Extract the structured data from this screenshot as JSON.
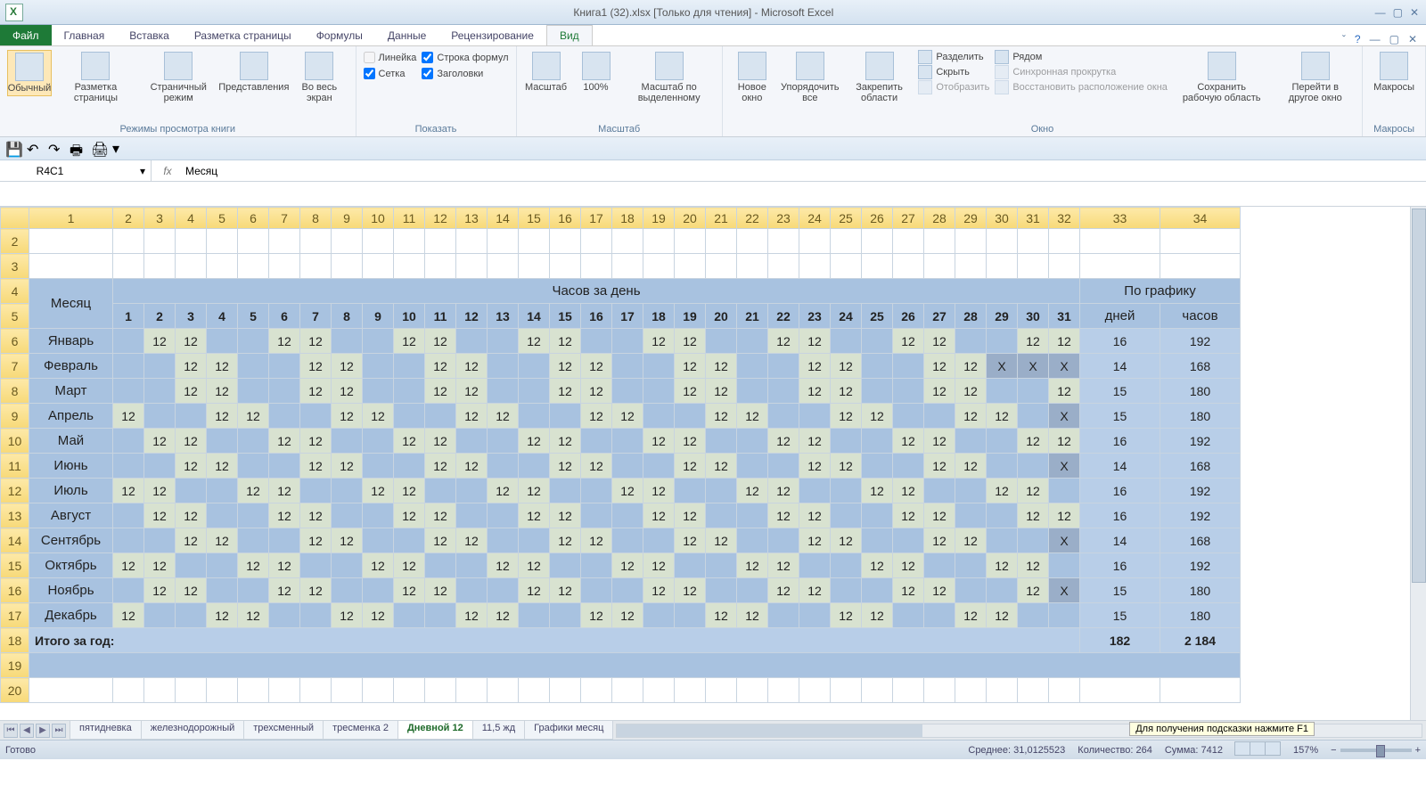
{
  "titlebar": {
    "title": "Книга1 (32).xlsx  [Только для чтения]  -  Microsoft Excel"
  },
  "tabs": {
    "file": "Файл",
    "items": [
      "Главная",
      "Вставка",
      "Разметка страницы",
      "Формулы",
      "Данные",
      "Рецензирование",
      "Вид"
    ],
    "active": "Вид"
  },
  "ribbon": {
    "groups": {
      "views": {
        "label": "Режимы просмотра книги",
        "normal": "Обычный",
        "pagelayout": "Разметка страницы",
        "pagebreak": "Страничный режим",
        "custom": "Представления",
        "full": "Во весь экран"
      },
      "show": {
        "label": "Показать",
        "ruler": "Линейка",
        "formula": "Строка формул",
        "grid": "Сетка",
        "headings": "Заголовки"
      },
      "zoom": {
        "label": "Масштаб",
        "zoom": "Масштаб",
        "z100": "100%",
        "zsel": "Масштаб по выделенному"
      },
      "window": {
        "label": "Окно",
        "neww": "Новое окно",
        "arrange": "Упорядочить все",
        "freeze": "Закрепить области",
        "split": "Разделить",
        "hide": "Скрыть",
        "unhide": "Отобразить",
        "side": "Рядом",
        "sync": "Синхронная прокрутка",
        "reset": "Восстановить расположение окна",
        "save": "Сохранить рабочую область",
        "switch": "Перейти в другое окно"
      },
      "macros": {
        "label": "Макросы",
        "btn": "Макросы"
      }
    }
  },
  "namebox": "R4C1",
  "formula": "Месяц",
  "columns": [
    "1",
    "2",
    "3",
    "4",
    "5",
    "6",
    "7",
    "8",
    "9",
    "10",
    "11",
    "12",
    "13",
    "14",
    "15",
    "16",
    "17",
    "18",
    "19",
    "20",
    "21",
    "22",
    "23",
    "24",
    "25",
    "26",
    "27",
    "28",
    "29",
    "30",
    "31",
    "32",
    "33",
    "34"
  ],
  "headers": {
    "month": "Месяц",
    "hoursPerDay": "Часов за день",
    "bySchedule": "По графику",
    "days": "дней",
    "hours": "часов"
  },
  "dayNums": [
    "1",
    "2",
    "3",
    "4",
    "5",
    "6",
    "7",
    "8",
    "9",
    "10",
    "11",
    "12",
    "13",
    "14",
    "15",
    "16",
    "17",
    "18",
    "19",
    "20",
    "21",
    "22",
    "23",
    "24",
    "25",
    "26",
    "27",
    "28",
    "29",
    "30",
    "31"
  ],
  "months": [
    {
      "name": "Январь",
      "cells": [
        "",
        "12",
        "12",
        "",
        "",
        "12",
        "12",
        "",
        "",
        "12",
        "12",
        "",
        "",
        "12",
        "12",
        "",
        "",
        "12",
        "12",
        "",
        "",
        "12",
        "12",
        "",
        "",
        "12",
        "12",
        "",
        "",
        "12",
        "12"
      ],
      "days": "16",
      "hours": "192"
    },
    {
      "name": "Февраль",
      "cells": [
        "",
        "",
        "12",
        "12",
        "",
        "",
        "12",
        "12",
        "",
        "",
        "12",
        "12",
        "",
        "",
        "12",
        "12",
        "",
        "",
        "12",
        "12",
        "",
        "",
        "12",
        "12",
        "",
        "",
        "12",
        "12",
        "X",
        "X",
        "X"
      ],
      "days": "14",
      "hours": "168"
    },
    {
      "name": "Март",
      "cells": [
        "",
        "",
        "12",
        "12",
        "",
        "",
        "12",
        "12",
        "",
        "",
        "12",
        "12",
        "",
        "",
        "12",
        "12",
        "",
        "",
        "12",
        "12",
        "",
        "",
        "12",
        "12",
        "",
        "",
        "12",
        "12",
        "",
        "",
        "12"
      ],
      "days": "15",
      "hours": "180"
    },
    {
      "name": "Апрель",
      "cells": [
        "12",
        "",
        "",
        "12",
        "12",
        "",
        "",
        "12",
        "12",
        "",
        "",
        "12",
        "12",
        "",
        "",
        "12",
        "12",
        "",
        "",
        "12",
        "12",
        "",
        "",
        "12",
        "12",
        "",
        "",
        "12",
        "12",
        "",
        "X"
      ],
      "days": "15",
      "hours": "180"
    },
    {
      "name": "Май",
      "cells": [
        "",
        "12",
        "12",
        "",
        "",
        "12",
        "12",
        "",
        "",
        "12",
        "12",
        "",
        "",
        "12",
        "12",
        "",
        "",
        "12",
        "12",
        "",
        "",
        "12",
        "12",
        "",
        "",
        "12",
        "12",
        "",
        "",
        "12",
        "12"
      ],
      "days": "16",
      "hours": "192"
    },
    {
      "name": "Июнь",
      "cells": [
        "",
        "",
        "12",
        "12",
        "",
        "",
        "12",
        "12",
        "",
        "",
        "12",
        "12",
        "",
        "",
        "12",
        "12",
        "",
        "",
        "12",
        "12",
        "",
        "",
        "12",
        "12",
        "",
        "",
        "12",
        "12",
        "",
        "",
        "X"
      ],
      "days": "14",
      "hours": "168"
    },
    {
      "name": "Июль",
      "cells": [
        "12",
        "12",
        "",
        "",
        "12",
        "12",
        "",
        "",
        "12",
        "12",
        "",
        "",
        "12",
        "12",
        "",
        "",
        "12",
        "12",
        "",
        "",
        "12",
        "12",
        "",
        "",
        "12",
        "12",
        "",
        "",
        "12",
        "12",
        ""
      ],
      "days": "16",
      "hours": "192"
    },
    {
      "name": "Август",
      "cells": [
        "",
        "12",
        "12",
        "",
        "",
        "12",
        "12",
        "",
        "",
        "12",
        "12",
        "",
        "",
        "12",
        "12",
        "",
        "",
        "12",
        "12",
        "",
        "",
        "12",
        "12",
        "",
        "",
        "12",
        "12",
        "",
        "",
        "12",
        "12"
      ],
      "days": "16",
      "hours": "192"
    },
    {
      "name": "Сентябрь",
      "cells": [
        "",
        "",
        "12",
        "12",
        "",
        "",
        "12",
        "12",
        "",
        "",
        "12",
        "12",
        "",
        "",
        "12",
        "12",
        "",
        "",
        "12",
        "12",
        "",
        "",
        "12",
        "12",
        "",
        "",
        "12",
        "12",
        "",
        "",
        "X"
      ],
      "days": "14",
      "hours": "168"
    },
    {
      "name": "Октябрь",
      "cells": [
        "12",
        "12",
        "",
        "",
        "12",
        "12",
        "",
        "",
        "12",
        "12",
        "",
        "",
        "12",
        "12",
        "",
        "",
        "12",
        "12",
        "",
        "",
        "12",
        "12",
        "",
        "",
        "12",
        "12",
        "",
        "",
        "12",
        "12",
        ""
      ],
      "days": "16",
      "hours": "192"
    },
    {
      "name": "Ноябрь",
      "cells": [
        "",
        "12",
        "12",
        "",
        "",
        "12",
        "12",
        "",
        "",
        "12",
        "12",
        "",
        "",
        "12",
        "12",
        "",
        "",
        "12",
        "12",
        "",
        "",
        "12",
        "12",
        "",
        "",
        "12",
        "12",
        "",
        "",
        "12",
        "X"
      ],
      "days": "15",
      "hours": "180"
    },
    {
      "name": "Декабрь",
      "cells": [
        "12",
        "",
        "",
        "12",
        "12",
        "",
        "",
        "12",
        "12",
        "",
        "",
        "12",
        "12",
        "",
        "",
        "12",
        "12",
        "",
        "",
        "12",
        "12",
        "",
        "",
        "12",
        "12",
        "",
        "",
        "12",
        "12",
        "",
        ""
      ],
      "days": "15",
      "hours": "180"
    }
  ],
  "totalRow": {
    "label": "Итого за год:",
    "days": "182",
    "hours": "2 184"
  },
  "sheets": [
    "пятидневка",
    "железнодорожный",
    "трехсменный",
    "тресменка 2",
    "Дневной 12",
    "11,5 жд",
    "Графики месяц"
  ],
  "activeSheet": "Дневной 12",
  "tooltip": "Для получения подсказки нажмите F1",
  "status": {
    "ready": "Готово",
    "avg": "Среднее: 31,0125523",
    "count": "Количество: 264",
    "sum": "Сумма: 7412",
    "zoom": "157%"
  }
}
